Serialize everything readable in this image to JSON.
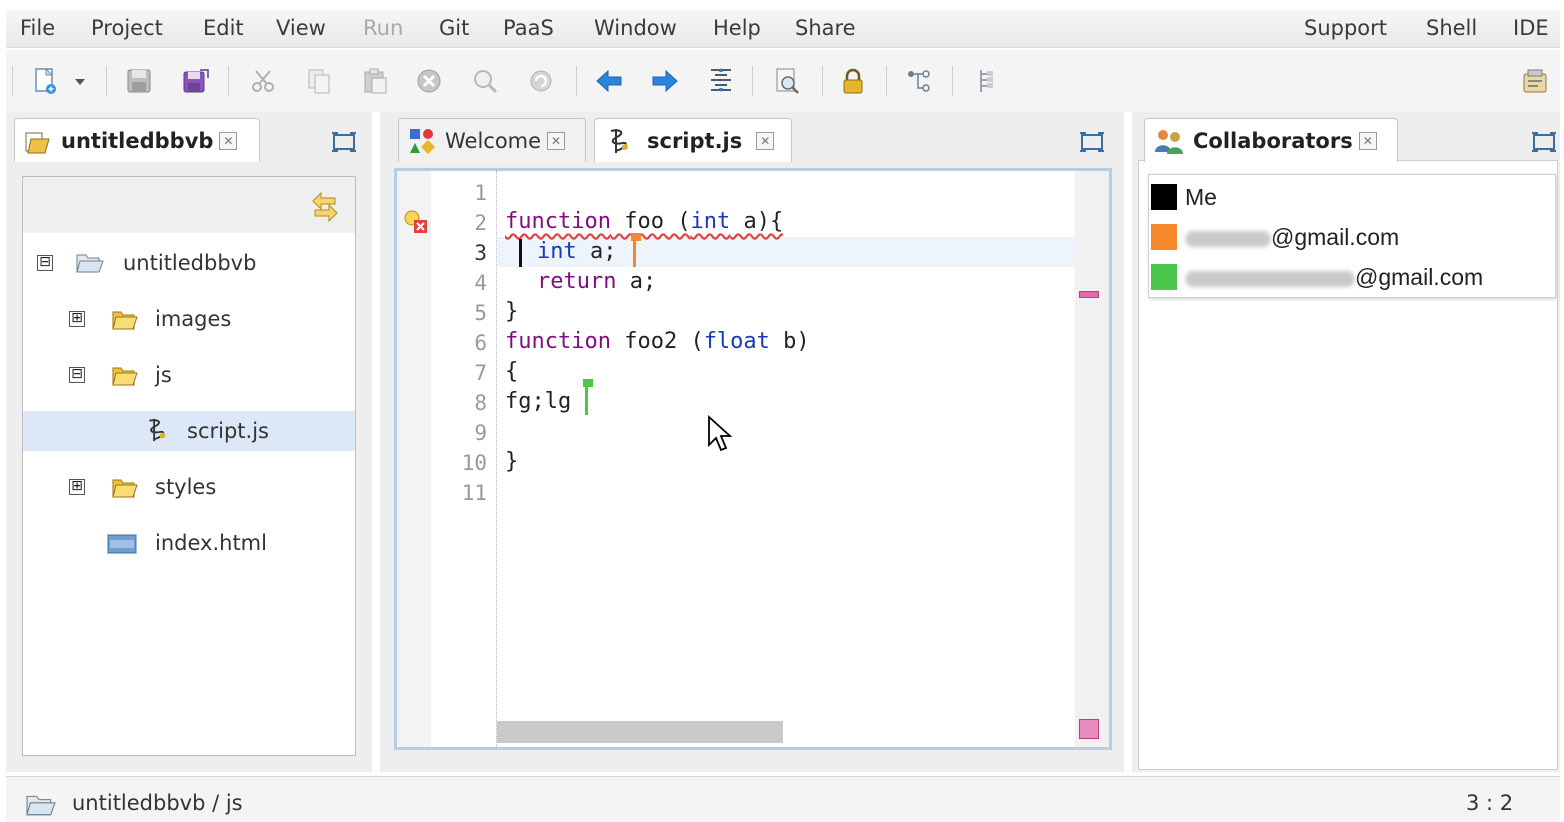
{
  "menubar": {
    "left": [
      {
        "label": "File",
        "enabled": true
      },
      {
        "label": "Project",
        "enabled": true
      },
      {
        "label": "Edit",
        "enabled": true
      },
      {
        "label": "View",
        "enabled": true
      },
      {
        "label": "Run",
        "enabled": false
      },
      {
        "label": "Git",
        "enabled": true
      },
      {
        "label": "PaaS",
        "enabled": true
      },
      {
        "label": "Window",
        "enabled": true
      },
      {
        "label": "Help",
        "enabled": true
      },
      {
        "label": "Share",
        "enabled": true
      }
    ],
    "right": [
      {
        "label": "Support"
      },
      {
        "label": "Shell"
      },
      {
        "label": "IDE"
      }
    ]
  },
  "toolbar": {
    "icons": [
      "new-file-icon",
      "dropdown-arrow-icon",
      "save-icon",
      "save-all-icon",
      "cut-icon",
      "copy-icon",
      "paste-icon",
      "stop-icon",
      "find-icon",
      "refresh-icon",
      "back-arrow-icon",
      "forward-arrow-icon",
      "format-icon",
      "preview-icon",
      "lock-icon",
      "git-branch-icon",
      "outline-icon",
      "ide-settings-icon"
    ]
  },
  "project_panel": {
    "tab_label": "untitledbbvb",
    "tree": [
      {
        "label": "untitledbbvb",
        "type": "folder-open",
        "expander": "⊟",
        "depth": 0
      },
      {
        "label": "images",
        "type": "folder",
        "expander": "⊞",
        "depth": 1
      },
      {
        "label": "js",
        "type": "folder",
        "expander": "⊟",
        "depth": 1
      },
      {
        "label": "script.js",
        "type": "js-file",
        "expander": "",
        "depth": 2,
        "selected": true
      },
      {
        "label": "styles",
        "type": "folder",
        "expander": "⊞",
        "depth": 1
      },
      {
        "label": "index.html",
        "type": "html-file",
        "expander": "",
        "depth": 1
      }
    ]
  },
  "editor": {
    "tabs": [
      {
        "label": "Welcome",
        "active": false
      },
      {
        "label": "script.js",
        "active": true
      }
    ],
    "line_numbers": [
      "1",
      "2",
      "3",
      "4",
      "5",
      "6",
      "7",
      "8",
      "9",
      "10",
      "11"
    ],
    "current_line": "3",
    "code": {
      "l2_kw": "function",
      "l2_a": " foo (",
      "l2_ty": "int",
      "l2_b": " a){",
      "l3_ty": "int",
      "l3_rest": " a;",
      "l4_kw": "return",
      "l4_rest": " a;",
      "l5": "}",
      "l6_kw": "function",
      "l6_a": " foo2 (",
      "l6_ty": "float",
      "l6_b": " b)",
      "l7": "{",
      "l8": "fg;lg",
      "l10": "}"
    }
  },
  "collaborators": {
    "tab_label": "Collaborators",
    "items": [
      {
        "name": "Me",
        "color": "#000000"
      },
      {
        "name": "@gmail.com",
        "color": "#f5882a"
      },
      {
        "name": "@gmail.com",
        "color": "#4cc74c"
      }
    ]
  },
  "status": {
    "path": "untitledbbvb / js",
    "position": "3 : 2"
  },
  "colors": {
    "accent": "#1a7fe6",
    "selection": "#dce8f7",
    "error": "#e04040",
    "keyword": "#7f0f7f",
    "type": "#1838c0"
  }
}
